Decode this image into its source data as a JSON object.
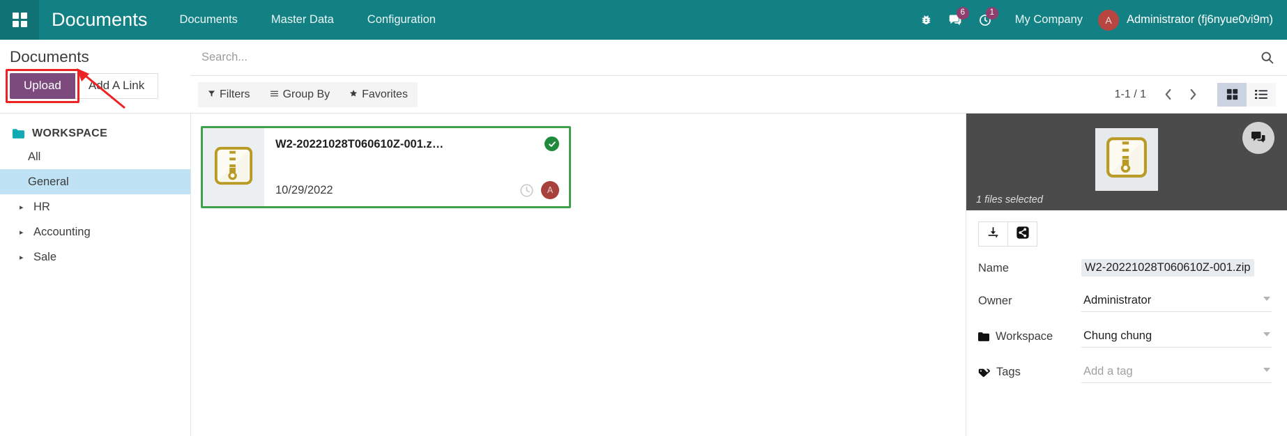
{
  "topbar": {
    "apps_icon": "apps-grid-icon",
    "brand": "Documents",
    "menu": [
      {
        "label": "Documents"
      },
      {
        "label": "Master Data"
      },
      {
        "label": "Configuration"
      }
    ],
    "sysicons": [
      {
        "name": "bug-icon",
        "badge": null
      },
      {
        "name": "messages-icon",
        "badge": "6"
      },
      {
        "name": "activities-clock-icon",
        "badge": "1"
      }
    ],
    "company": "My Company",
    "user": {
      "initial": "A",
      "name": "Administrator (fj6nyue0vi9m)"
    },
    "bg_color": "#138184",
    "badge_color": "#8f3e6e"
  },
  "controls": {
    "page_title": "Documents",
    "upload_label": "Upload",
    "add_link_label": "Add A Link",
    "upload_color": "#7c4a7d",
    "highlight_color": "#ee2222"
  },
  "search": {
    "placeholder": "Search...",
    "value": "",
    "search_icon": "search-icon"
  },
  "filters": {
    "filters_label": "Filters",
    "group_by_label": "Group By",
    "favorites_label": "Favorites",
    "pager_count": "1-1 / 1",
    "prev_icon": "chevron-left-icon",
    "next_icon": "chevron-right-icon",
    "view_kanban": "kanban-view-icon",
    "view_list": "list-view-icon",
    "active_view": "kanban"
  },
  "sidebar": {
    "header": "WORKSPACE",
    "items": [
      {
        "label": "All",
        "expandable": false,
        "selected": false
      },
      {
        "label": "General",
        "expandable": false,
        "selected": true
      },
      {
        "label": "HR",
        "expandable": true,
        "selected": false
      },
      {
        "label": "Accounting",
        "expandable": true,
        "selected": false
      },
      {
        "label": "Sale",
        "expandable": true,
        "selected": false
      }
    ]
  },
  "documents": [
    {
      "name": "W2-20221028T060610Z-001.z…",
      "date": "10/29/2022",
      "thumb_icon": "zip-file-icon",
      "selected": true,
      "status_icon": "check-circle-icon",
      "clock_icon": "clock-icon",
      "owner_initial": "A",
      "border_color": "#3fa14b"
    }
  ],
  "right_panel": {
    "preview_icon": "zip-file-icon",
    "chat_icon": "chat-bubble-icon",
    "files_selected": "1 files selected",
    "actions": [
      {
        "name": "download-button",
        "icon": "download-icon"
      },
      {
        "name": "share-button",
        "icon": "share-icon"
      }
    ],
    "fields": [
      {
        "key": "name",
        "label": "Name",
        "value": "W2-20221028T060610Z-001.zip",
        "type": "text",
        "icon": null
      },
      {
        "key": "owner",
        "label": "Owner",
        "value": "Administrator",
        "type": "select",
        "icon": null
      },
      {
        "key": "workspace",
        "label": "Workspace",
        "value": "Chung chung",
        "type": "select",
        "icon": "folder-icon"
      },
      {
        "key": "tags",
        "label": "Tags",
        "value": "Add a tag",
        "type": "select",
        "icon": "tag-icon",
        "placeholder": true
      }
    ]
  }
}
